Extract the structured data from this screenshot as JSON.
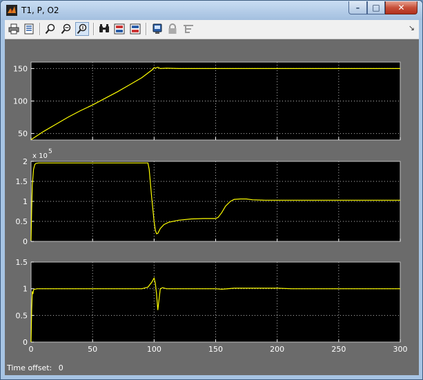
{
  "window": {
    "title": "T1, P, O2"
  },
  "titlebar_buttons": {
    "minimize": "–",
    "maximize": "□",
    "close": "✕"
  },
  "toolbar": {
    "tools": [
      "print-icon",
      "parameters-icon",
      "zoom-icon",
      "zoom-x-icon",
      "zoom-y-icon",
      "autoscale-icon",
      "save-axes-icon",
      "restore-axes-icon",
      "floating-scope-icon",
      "lock-axes-icon",
      "signal-selection-icon"
    ],
    "overflow": "↘"
  },
  "status": {
    "label": "Time offset:",
    "value": "0"
  },
  "colors": {
    "trace": "#ffff00",
    "plot_bg": "#000000",
    "frame": "#6b6b6b",
    "axis_text": "#ffffff"
  },
  "chart_data": [
    {
      "type": "line",
      "xlim": [
        0,
        300
      ],
      "ylim": [
        40,
        160
      ],
      "yticks": [
        50,
        100,
        150
      ],
      "xticks": [
        0,
        50,
        100,
        150,
        200,
        250,
        300
      ],
      "show_xtick_labels": false,
      "exponent": "",
      "grid": true,
      "series": [
        {
          "color": "#ffff00",
          "x": [
            0,
            10,
            20,
            30,
            40,
            50,
            60,
            70,
            80,
            90,
            99,
            100,
            101,
            103,
            105,
            110,
            120,
            150,
            200,
            250,
            300
          ],
          "y": [
            40.5,
            53,
            64,
            75,
            85,
            94,
            104,
            114,
            125,
            136,
            149,
            151.5,
            150.5,
            152,
            150,
            150.5,
            150,
            150,
            150,
            150,
            150
          ]
        }
      ]
    },
    {
      "type": "line",
      "xlim": [
        0,
        300
      ],
      "ylim": [
        0,
        2
      ],
      "yticks": [
        0,
        0.5,
        1,
        1.5,
        2
      ],
      "ytick_labels": [
        "0",
        "0.5",
        "1",
        "1.5",
        "2"
      ],
      "xticks": [
        0,
        50,
        100,
        150,
        200,
        250,
        300
      ],
      "show_xtick_labels": false,
      "exponent": "x 10",
      "exponent_power": "5",
      "grid": true,
      "series": [
        {
          "color": "#ffff00",
          "x": [
            0,
            0.5,
            1,
            2,
            3,
            4,
            6,
            10,
            30,
            60,
            90,
            95,
            96,
            98,
            100,
            101,
            102,
            103,
            105,
            108,
            112,
            120,
            130,
            140,
            150,
            152,
            155,
            158,
            162,
            165,
            170,
            175,
            180,
            190,
            200,
            250,
            300
          ],
          "y": [
            0.02,
            0.8,
            1.4,
            1.8,
            1.92,
            1.95,
            1.96,
            1.96,
            1.96,
            1.96,
            1.96,
            1.96,
            1.8,
            1.1,
            0.5,
            0.28,
            0.19,
            0.2,
            0.32,
            0.42,
            0.48,
            0.53,
            0.56,
            0.57,
            0.57,
            0.6,
            0.72,
            0.88,
            1.0,
            1.05,
            1.06,
            1.06,
            1.04,
            1.03,
            1.03,
            1.03,
            1.03
          ]
        }
      ]
    },
    {
      "type": "line",
      "xlim": [
        0,
        300
      ],
      "ylim": [
        0,
        1.5
      ],
      "yticks": [
        0,
        0.5,
        1,
        1.5
      ],
      "ytick_labels": [
        "0",
        "0.5",
        "1",
        "1.5"
      ],
      "xticks": [
        0,
        50,
        100,
        150,
        200,
        250,
        300
      ],
      "xtick_labels": [
        "0",
        "50",
        "100",
        "150",
        "200",
        "250",
        "300"
      ],
      "show_xtick_labels": true,
      "exponent": "",
      "grid": true,
      "series": [
        {
          "color": "#ffff00",
          "x": [
            0,
            0.5,
            1,
            1.5,
            2,
            3,
            5,
            10,
            50,
            90,
            95,
            98,
            100,
            101,
            102,
            103,
            104,
            105,
            107,
            110,
            120,
            150,
            155,
            165,
            200,
            212,
            250,
            300
          ],
          "y": [
            0,
            0.6,
            0.95,
            0.9,
            0.98,
            0.99,
            1.0,
            1.0,
            1.0,
            1.0,
            1.03,
            1.12,
            1.2,
            1.1,
            0.9,
            0.6,
            0.8,
            1.0,
            1.02,
            1.0,
            1.0,
            1.0,
            0.99,
            1.01,
            1.01,
            1.0,
            1.0,
            1.0
          ]
        }
      ]
    }
  ]
}
